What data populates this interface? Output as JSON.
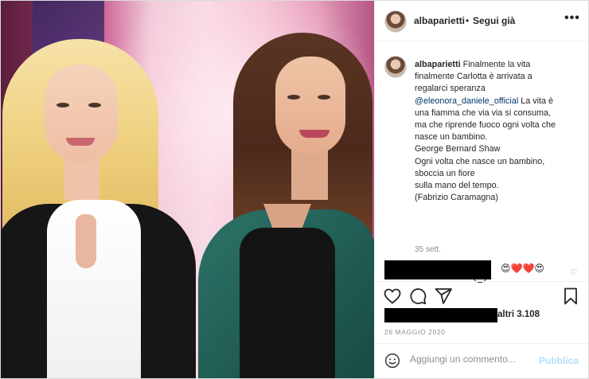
{
  "post": {
    "username": "albaparietti",
    "separator": "•",
    "follow_label": "Segui già",
    "more_label": "•••"
  },
  "caption": {
    "username": "albaparietti",
    "lines": [
      "Finalmente la vita",
      "finalmente Carlotta è arrivata a",
      "regalarci speranza",
      "@eleonora_daniele_official",
      " La vita è",
      "una fiamma che via via si consuma,",
      "ma che riprende fuoco ogni volta che",
      "nasce un bambino.",
      "George Bernard Shaw",
      "Ogni volta che nasce un bambino,",
      "sboccia un fiore",
      "sulla mano del tempo.",
      "(Fabrizio Caramagna)"
    ],
    "age": "35 sett."
  },
  "comment": {
    "emojis": "😍❤️❤️😍"
  },
  "likes": {
    "text": "altri 3.108"
  },
  "date": "26 MAGGIO 2020",
  "add_comment": {
    "placeholder": "Aggiungi un commento...",
    "publish_label": "Pubblica"
  },
  "icons": [
    "heart-icon",
    "comment-icon",
    "share-icon",
    "bookmark-icon",
    "add-icon",
    "smile-icon",
    "like-comment-icon"
  ],
  "colors": {
    "mention": "#00376b",
    "publish": "#b2dffc",
    "muted": "#8e8e8e"
  }
}
